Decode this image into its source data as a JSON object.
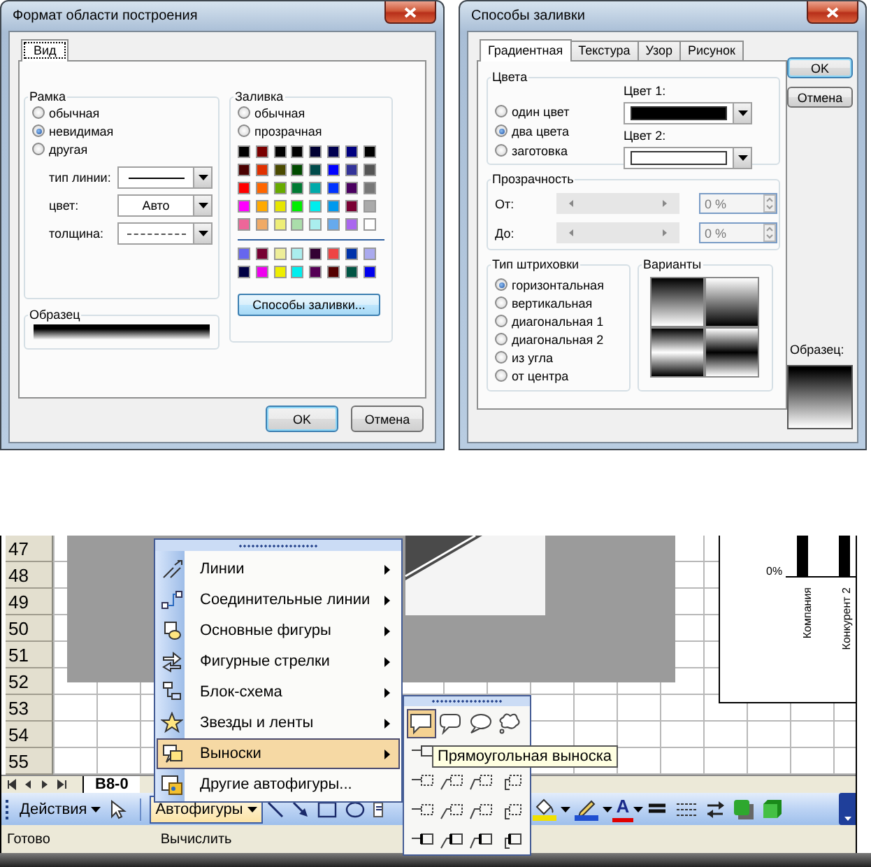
{
  "format_dialog": {
    "title": "Формат области построения",
    "tabs": [
      {
        "label": "Вид",
        "selected": true
      }
    ],
    "border_group": {
      "title": "Рамка",
      "options": [
        {
          "label": "обычная",
          "selected": false
        },
        {
          "label": "невидимая",
          "selected": true
        },
        {
          "label": "другая",
          "selected": false
        }
      ],
      "fields": [
        {
          "label": "тип линии:",
          "kind": "line"
        },
        {
          "label": "цвет:",
          "kind": "text",
          "value": "Авто"
        },
        {
          "label": "толщина:",
          "kind": "dashed"
        }
      ]
    },
    "sample": {
      "title": "Образец"
    },
    "fill_group": {
      "title": "Заливка",
      "options": [
        {
          "label": "обычная",
          "selected": false
        },
        {
          "label": "прозрачная",
          "selected": false
        }
      ],
      "palette": [
        {
          "color": "#000000"
        },
        {
          "color": "#7a0000"
        },
        {
          "color": "#000000"
        },
        {
          "color": "#000000"
        },
        {
          "color": "#000033"
        },
        {
          "color": "#000050"
        },
        {
          "color": "#000080"
        },
        {
          "color": "#000000"
        },
        {
          "color": "#4a0000"
        },
        {
          "color": "#e03000"
        },
        {
          "color": "#4a4a00"
        },
        {
          "color": "#004a00"
        },
        {
          "color": "#004a4a"
        },
        {
          "color": "#0000ff"
        },
        {
          "color": "#333399"
        },
        {
          "color": "#555555"
        },
        {
          "color": "#ff0000"
        },
        {
          "color": "#ff6600"
        },
        {
          "color": "#66aa00"
        },
        {
          "color": "#007a33"
        },
        {
          "color": "#00aaaa"
        },
        {
          "color": "#0033ff"
        },
        {
          "color": "#4a0060"
        },
        {
          "color": "#777777"
        },
        {
          "color": "#ff00ff"
        },
        {
          "color": "#ffaa00"
        },
        {
          "color": "#e6e600"
        },
        {
          "color": "#00ee00"
        },
        {
          "color": "#00eeee"
        },
        {
          "color": "#0099ee"
        },
        {
          "color": "#7a0033"
        },
        {
          "color": "#aaaaaa"
        },
        {
          "color": "#ee6699"
        },
        {
          "color": "#f0aa66"
        },
        {
          "color": "#eeee77"
        },
        {
          "color": "#aaddaa"
        },
        {
          "color": "#aaeeee"
        },
        {
          "color": "#66aaee"
        },
        {
          "color": "#aa66ee"
        },
        {
          "color": "#ffffff"
        }
      ],
      "extra_palette": [
        {
          "color": "#6666ee"
        },
        {
          "color": "#770033"
        },
        {
          "color": "#eeee99"
        },
        {
          "color": "#aaeeee"
        },
        {
          "color": "#330033"
        },
        {
          "color": "#ee4444"
        },
        {
          "color": "#0033aa"
        },
        {
          "color": "#aaaaee"
        },
        {
          "color": "#000044"
        },
        {
          "color": "#ee00ee"
        },
        {
          "color": "#eeee00"
        },
        {
          "color": "#00eeee"
        },
        {
          "color": "#550055"
        },
        {
          "color": "#550000"
        },
        {
          "color": "#005544"
        },
        {
          "color": "#0000ee"
        }
      ],
      "button": "Способы заливки..."
    },
    "buttons": [
      {
        "label": "OK",
        "default": true
      },
      {
        "label": "Отмена",
        "default": false
      }
    ]
  },
  "fill_dialog": {
    "title": "Способы заливки",
    "tabs": [
      {
        "label": "Градиентная",
        "selected": true
      },
      {
        "label": "Текстура",
        "selected": false
      },
      {
        "label": "Узор",
        "selected": false
      },
      {
        "label": "Рисунок",
        "selected": false
      }
    ],
    "colors_group": {
      "title": "Цвета",
      "options": [
        {
          "label": "один цвет",
          "selected": false
        },
        {
          "label": "два цвета",
          "selected": true
        },
        {
          "label": "заготовка",
          "selected": false
        }
      ],
      "color_pickers": [
        {
          "label": "Цвет 1:",
          "color": "#000000"
        },
        {
          "label": "Цвет 2:",
          "color": "#ffffff"
        }
      ]
    },
    "transparency": {
      "title": "Прозрачность",
      "rows": [
        {
          "label": "От:",
          "value": "0 %",
          "disabled": true
        },
        {
          "label": "До:",
          "value": "0 %",
          "disabled": true
        }
      ]
    },
    "shading": {
      "title": "Тип штриховки",
      "options": [
        {
          "label": "горизонтальная",
          "selected": true
        },
        {
          "label": "вертикальная",
          "selected": false
        },
        {
          "label": "диагональная 1",
          "selected": false
        },
        {
          "label": "диагональная 2",
          "selected": false
        },
        {
          "label": "из угла",
          "selected": false
        },
        {
          "label": "от центра",
          "selected": false
        }
      ]
    },
    "variants": {
      "title": "Варианты"
    },
    "buttons": [
      {
        "label": "OK",
        "default": true
      },
      {
        "label": "Отмена",
        "default": false
      }
    ],
    "sample": {
      "label": "Образец:"
    }
  },
  "spreadsheet": {
    "row_numbers": [
      "47",
      "48",
      "49",
      "50",
      "51",
      "52",
      "53",
      "54",
      "55"
    ],
    "chart_labels": {
      "axis_value": "0%",
      "categories": [
        "Компания",
        "Конкурент 2"
      ]
    },
    "sheet_tab": "B8-0",
    "toolbar": {
      "actions": "Действия",
      "autoshapes": "Автофигуры",
      "font_color_glyph": "A"
    },
    "status_bar": {
      "left": "Готово",
      "right": "Вычислить"
    },
    "autoshapes_menu": {
      "items": [
        {
          "label": "Линии",
          "submenu": true,
          "selected": false
        },
        {
          "label": "Соединительные линии",
          "submenu": true,
          "selected": false
        },
        {
          "label": "Основные фигуры",
          "submenu": true,
          "selected": false
        },
        {
          "label": "Фигурные стрелки",
          "submenu": true,
          "selected": false
        },
        {
          "label": "Блок-схема",
          "submenu": true,
          "selected": false
        },
        {
          "label": "Звезды и ленты",
          "submenu": true,
          "selected": false
        },
        {
          "label": "Выноски",
          "submenu": true,
          "selected": true
        },
        {
          "label": "Другие автофигуры...",
          "submenu": false,
          "selected": false
        }
      ]
    },
    "callouts_palette": {
      "rows": [
        [
          {
            "selected": true
          },
          {
            "selected": false
          },
          {
            "selected": false
          },
          {
            "selected": false
          }
        ],
        [
          {
            "selected": false
          }
        ],
        [
          {
            "selected": false
          },
          {
            "selected": false
          },
          {
            "selected": false
          },
          {
            "selected": false
          }
        ],
        [
          {
            "selected": false
          },
          {
            "selected": false
          },
          {
            "selected": false
          },
          {
            "selected": false
          }
        ],
        [
          {
            "selected": false
          },
          {
            "selected": false
          },
          {
            "selected": false
          },
          {
            "selected": false
          }
        ]
      ]
    },
    "tooltip": "Прямоугольная выноска"
  }
}
